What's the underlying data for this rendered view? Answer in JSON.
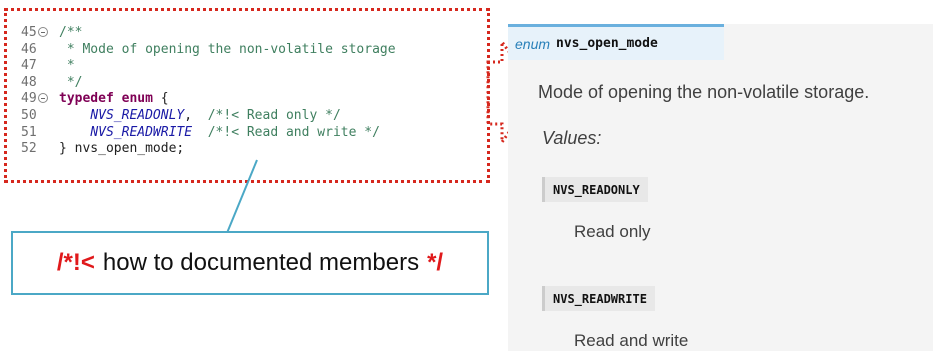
{
  "code": {
    "lines": [
      {
        "num": "45",
        "fold": true,
        "parts": [
          {
            "cls": "comment",
            "text": "/**"
          }
        ]
      },
      {
        "num": "46",
        "fold": false,
        "parts": [
          {
            "cls": "comment",
            "text": " * Mode of opening the non-volatile storage"
          }
        ]
      },
      {
        "num": "47",
        "fold": false,
        "parts": [
          {
            "cls": "comment",
            "text": " *"
          }
        ]
      },
      {
        "num": "48",
        "fold": false,
        "parts": [
          {
            "cls": "comment",
            "text": " */"
          }
        ]
      },
      {
        "num": "49",
        "fold": true,
        "parts": [
          {
            "cls": "kw",
            "text": "typedef enum"
          },
          {
            "cls": "plain",
            "text": " {"
          }
        ]
      },
      {
        "num": "50",
        "fold": false,
        "parts": [
          {
            "cls": "plain",
            "text": "    "
          },
          {
            "cls": "enumc",
            "text": "NVS_READONLY"
          },
          {
            "cls": "plain",
            "text": ",  "
          },
          {
            "cls": "comment",
            "text": "/*!< Read only */"
          }
        ]
      },
      {
        "num": "51",
        "fold": false,
        "parts": [
          {
            "cls": "plain",
            "text": "    "
          },
          {
            "cls": "enumc",
            "text": "NVS_READWRITE"
          },
          {
            "cls": "plain",
            "text": "  "
          },
          {
            "cls": "comment",
            "text": "/*!< Read and write */"
          }
        ]
      },
      {
        "num": "52",
        "fold": false,
        "parts": [
          {
            "cls": "plain",
            "text": "} nvs_open_mode;"
          }
        ]
      }
    ]
  },
  "callout": {
    "open_marker": "/*!<",
    "text": "how to documented members",
    "close_marker": "*/"
  },
  "docs": {
    "header_keyword": "enum",
    "header_name": "nvs_open_mode",
    "description": "Mode of opening the non-volatile storage.",
    "values_label": "Values:",
    "members": [
      {
        "name": "NVS_READONLY",
        "desc": "Read only"
      },
      {
        "name": "NVS_READWRITE",
        "desc": "Read and write"
      }
    ]
  },
  "colors": {
    "dotted_border": "#d6281e",
    "callout_border": "#4ba8c6",
    "callout_marker": "#e0191b",
    "docs_header_bg": "#e7f2fa",
    "docs_header_accent": "#6ab0de"
  }
}
